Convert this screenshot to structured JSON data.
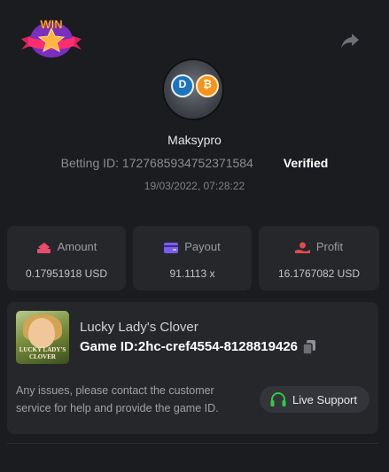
{
  "badge": {
    "text": "WIN"
  },
  "player": {
    "username": "Maksypro",
    "avatar_coins": [
      "D",
      "₿"
    ]
  },
  "bet": {
    "id_label": "Betting ID: 1727685934752371584",
    "status": "Verified",
    "datetime": "19/03/2022, 07:28:22"
  },
  "stats": [
    {
      "label": "Amount",
      "value": "0.17951918 USD",
      "icon": "amount-icon",
      "color": "#e84c6a"
    },
    {
      "label": "Payout",
      "value": "91.1113 x",
      "icon": "payout-icon",
      "color": "#7b5cf0"
    },
    {
      "label": "Profit",
      "value": "16.1767082 USD",
      "icon": "profit-icon",
      "color": "#e24b4b"
    }
  ],
  "game": {
    "name": "Lucky Lady's Clover",
    "id_label": "Game ID:2hc-cref4554-8128819426",
    "thumb_text": "LUCKY LADY'S CLOVER"
  },
  "support": {
    "message": "Any issues, please contact the customer service for help and provide the game ID.",
    "button_label": "Live Support"
  },
  "colors": {
    "background": "#1b1c1f",
    "card": "#26272b",
    "support_green": "#2ecc40"
  }
}
